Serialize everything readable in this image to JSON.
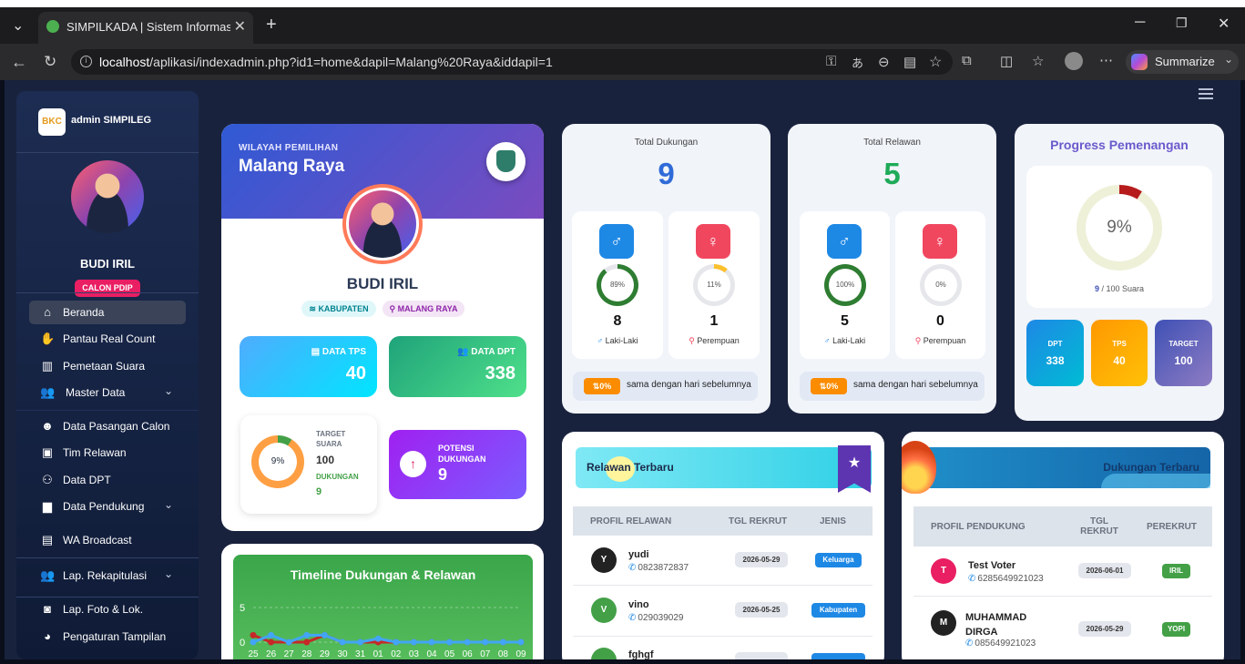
{
  "browser": {
    "tab_title": "SIMPILKADA | Sistem Informasi Ma",
    "url_host": "localhost",
    "url_path": "/aplikasi/indexadmin.php?id1=home&dapil=Malang%20Raya&iddapil=1",
    "summarize": "Summarize"
  },
  "sidebar": {
    "brand": "BKC",
    "title": "admin SIMPILEG",
    "user_name": "BUDI IRIL",
    "user_badge": "CALON PDIP",
    "items": [
      {
        "label": "Beranda"
      },
      {
        "label": "Pantau Real Count"
      },
      {
        "label": "Pemetaan Suara"
      },
      {
        "label": "Master Data"
      },
      {
        "label": "Data Pasangan Calon"
      },
      {
        "label": "Tim Relawan"
      },
      {
        "label": "Data DPT"
      },
      {
        "label": "Data Pendukung"
      },
      {
        "label": "WA Broadcast"
      },
      {
        "label": "Lap. Rekapitulasi"
      },
      {
        "label": "Lap. Foto & Lok."
      },
      {
        "label": "Pengaturan Tampilan"
      }
    ]
  },
  "wilayah": {
    "kicker": "WILAYAH PEMILIHAN",
    "region": "Malang Raya",
    "name": "BUDI IRIL",
    "tag_level": "KABUPATEN",
    "tag_region": "MALANG RAYA",
    "tps_label": "DATA TPS",
    "tps_value": "40",
    "dpt_label": "DATA DPT",
    "dpt_value": "338",
    "target_label": "TARGET SUARA",
    "target_value": "100",
    "dukungan_label": "DUKUNGAN",
    "dukungan_value": "9",
    "ring_pct": "9%",
    "ring_fraction": 0.09,
    "potensi_label": "POTENSI DUKUNGAN",
    "potensi_value": "9"
  },
  "dukungan": {
    "title": "Total Dukungan",
    "total": "9",
    "male": {
      "pct": "89%",
      "frac": 0.89,
      "count": "8",
      "label": "Laki-Laki"
    },
    "female": {
      "pct": "11%",
      "frac": 0.11,
      "count": "1",
      "label": "Perempuan"
    },
    "change": "0%",
    "note": "sama dengan hari sebelumnya"
  },
  "relawan": {
    "title": "Total Relawan",
    "total": "5",
    "male": {
      "pct": "100%",
      "frac": 1.0,
      "count": "5",
      "label": "Laki-Laki"
    },
    "female": {
      "pct": "0%",
      "frac": 0.0,
      "count": "0",
      "label": "Perempuan"
    },
    "change": "0%",
    "note": "sama dengan hari sebelumnya"
  },
  "progress": {
    "title": "Progress Pemenangan",
    "pct": "9%",
    "frac": 0.09,
    "current": "9",
    "suffix": "/ 100 Suara",
    "tiles": [
      {
        "label": "DPT",
        "value": "338"
      },
      {
        "label": "TPS",
        "value": "40"
      },
      {
        "label": "TARGET",
        "value": "100"
      }
    ]
  },
  "timeline": {
    "title": "Timeline Dukungan & Relawan"
  },
  "chart_data": {
    "type": "line",
    "title": "Timeline Dukungan & Relawan",
    "ylim": [
      0,
      5
    ],
    "yticks": [
      "5",
      "0"
    ],
    "categories": [
      "25",
      "26",
      "27",
      "28",
      "29",
      "30",
      "31",
      "01",
      "02",
      "03",
      "04",
      "05",
      "06",
      "07",
      "08",
      "09"
    ],
    "series": [
      {
        "values": [
          1,
          0,
          0,
          0,
          1,
          0,
          0,
          0,
          0,
          0,
          0,
          0,
          0,
          0,
          0,
          0
        ],
        "color": "#c62828"
      },
      {
        "values": [
          0,
          1,
          0,
          1,
          1,
          0,
          0,
          0.5,
          0,
          0,
          0,
          0,
          0,
          0,
          0,
          0
        ],
        "color": "#42a5f5"
      }
    ]
  },
  "relawan_table": {
    "title": "Relawan Terbaru",
    "headers": [
      "PROFIL RELAWAN",
      "TGL REKRUT",
      "JENIS"
    ],
    "rows": [
      {
        "initial": "Y",
        "name": "yudi",
        "phone": "0823872837",
        "date": "2026-05-29",
        "type": "Keluarga",
        "color": "#222",
        "tcolor": "#1e88e5"
      },
      {
        "initial": "V",
        "name": "vino",
        "phone": "029039029",
        "date": "2026-05-25",
        "type": "Kabupaten",
        "color": "#43a047",
        "tcolor": "#1e88e5"
      },
      {
        "initial": "",
        "name": "fghgf",
        "phone": "",
        "date": "",
        "type": "",
        "color": "#43a047",
        "tcolor": "#1e88e5"
      }
    ]
  },
  "pendukung_table": {
    "title": "Dukungan Terbaru",
    "headers": [
      "PROFIL PENDUKUNG",
      "TGL REKRUT",
      "PEREKRUT"
    ],
    "rows": [
      {
        "initial": "T",
        "name": "Test Voter",
        "phone": "6285649921023",
        "date": "2026-06-01",
        "rec": "IRIL",
        "color": "#e91e63"
      },
      {
        "initial": "M",
        "name": "MUHAMMAD DIRGA",
        "phone": "085649921023",
        "date": "2026-05-29",
        "rec": "YOPI",
        "color": "#222"
      }
    ]
  },
  "icons": {
    "home": "home-icon",
    "chev": "chevron-down-icon",
    "male": "male-icon",
    "female": "female-icon"
  }
}
